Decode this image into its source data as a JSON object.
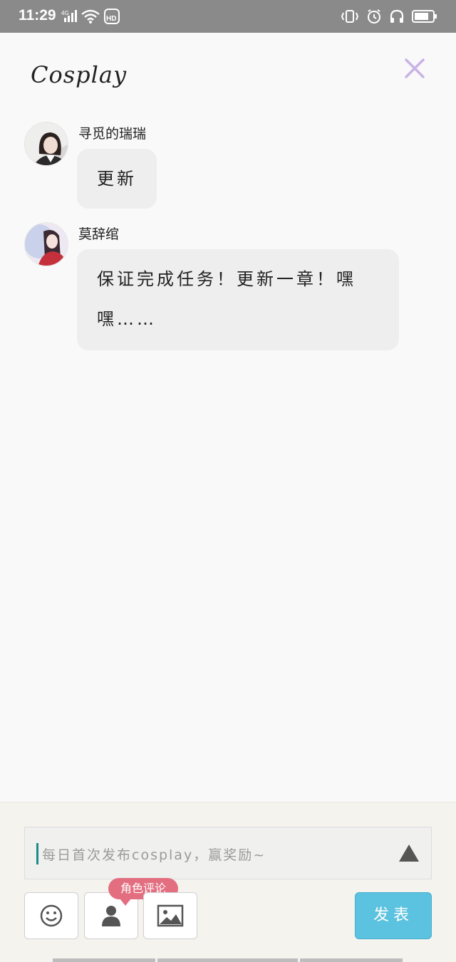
{
  "status_bar": {
    "time": "11:29",
    "network": "4G",
    "hd_label": "HD",
    "icons": [
      "signal-icon",
      "wifi-icon",
      "hd-icon",
      "vibrate-icon",
      "alarm-icon",
      "headset-icon",
      "battery-icon"
    ]
  },
  "page": {
    "title": "Cosplay"
  },
  "messages": [
    {
      "username": "寻觅的瑞瑞",
      "text": "更新"
    },
    {
      "username": "莫辞绾",
      "text": "保证完成任务！更新一章！嘿嘿……"
    }
  ],
  "composer": {
    "placeholder": "每日首次发布cosplay，赢奖励~",
    "role_tag": "角色评论",
    "post_label": "发表"
  },
  "colors": {
    "accent": "#5bc2df",
    "role_tag": "#e36e80",
    "close_icon": "#c9b3e6",
    "caret": "#1c8d86"
  }
}
